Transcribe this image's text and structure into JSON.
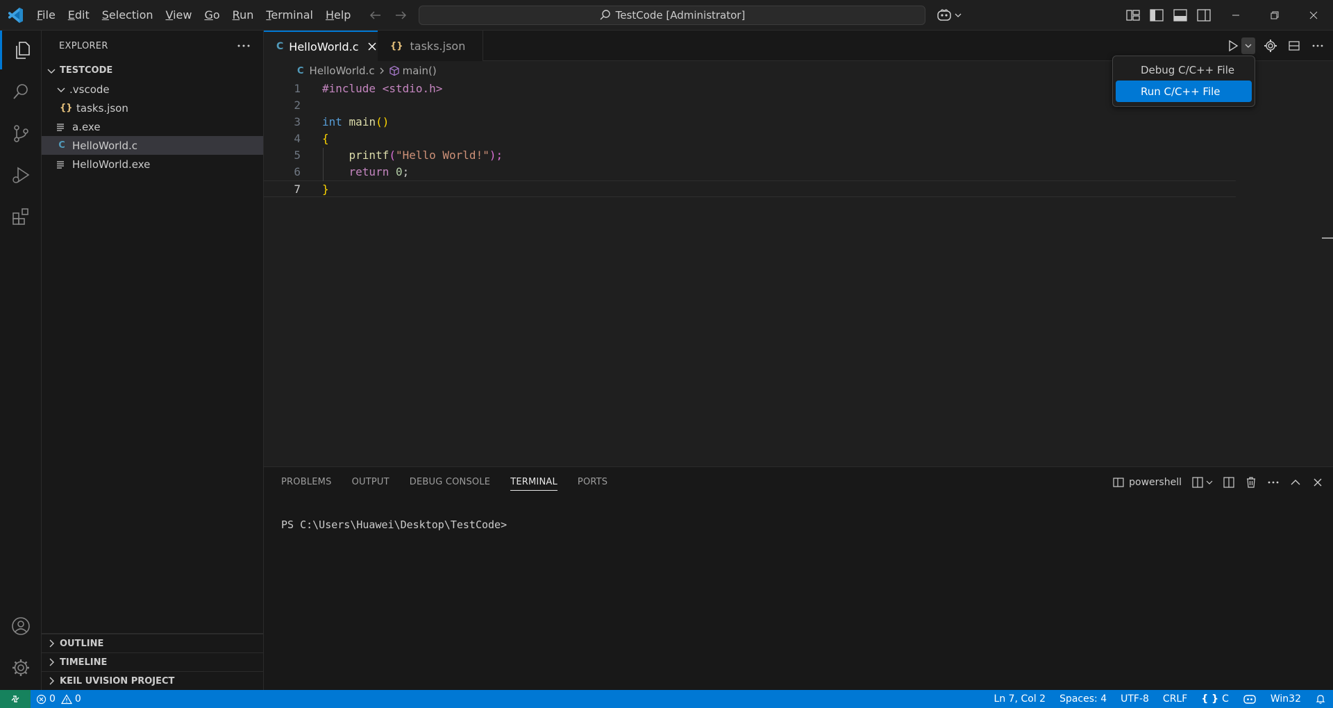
{
  "titlebar": {
    "menu": [
      {
        "label": "File",
        "key": "F",
        "rest": "ile"
      },
      {
        "label": "Edit",
        "key": "E",
        "rest": "dit"
      },
      {
        "label": "Selection",
        "key": "S",
        "rest": "election"
      },
      {
        "label": "View",
        "key": "V",
        "rest": "iew"
      },
      {
        "label": "Go",
        "key": "G",
        "rest": "o"
      },
      {
        "label": "Run",
        "key": "R",
        "rest": "un"
      },
      {
        "label": "Terminal",
        "key": "T",
        "rest": "erminal"
      },
      {
        "label": "Help",
        "key": "H",
        "rest": "elp"
      }
    ],
    "command_center": "TestCode [Administrator]"
  },
  "sidebar": {
    "title": "EXPLORER",
    "folder": "TESTCODE",
    "items": [
      {
        "label": ".vscode",
        "type": "folder"
      },
      {
        "label": "tasks.json",
        "type": "json",
        "icon": "{}"
      },
      {
        "label": "a.exe",
        "type": "file"
      },
      {
        "label": "HelloWorld.c",
        "type": "c",
        "icon": "C"
      },
      {
        "label": "HelloWorld.exe",
        "type": "file"
      }
    ],
    "bottom_sections": [
      "OUTLINE",
      "TIMELINE",
      "KEIL UVISION PROJECT"
    ]
  },
  "tabs": [
    {
      "label": "HelloWorld.c",
      "icon": "C",
      "active": true
    },
    {
      "label": "tasks.json",
      "icon": "{}",
      "active": false
    }
  ],
  "breadcrumbs": {
    "file": "HelloWorld.c",
    "symbol": "main()"
  },
  "editor": {
    "line_numbers": [
      "1",
      "2",
      "3",
      "4",
      "5",
      "6",
      "7"
    ],
    "current_line": 7,
    "code": {
      "l1_include": "#include <stdio.h>",
      "l3_type": "int",
      "l3_fn": "main",
      "l3_paren": "()",
      "l4": "{",
      "l5_fn": "printf",
      "l5_open": "(",
      "l5_str": "\"Hello World!\"",
      "l5_close": ");",
      "l6_kw": "return",
      "l6_num": "0",
      "l6_semi": ";",
      "l7": "}"
    }
  },
  "run_menu": {
    "items": [
      "Debug C/C++ File",
      "Run C/C++ File"
    ],
    "highlighted": "Run C/C++ File"
  },
  "panel": {
    "tabs": [
      "PROBLEMS",
      "OUTPUT",
      "DEBUG CONSOLE",
      "TERMINAL",
      "PORTS"
    ],
    "active_tab": "TERMINAL",
    "shell": "powershell",
    "terminal_prompt": "PS C:\\Users\\Huawei\\Desktop\\TestCode>"
  },
  "statusbar": {
    "errors": "0",
    "warnings": "0",
    "position": "Ln 7, Col 2",
    "spaces": "Spaces: 4",
    "encoding": "UTF-8",
    "eol": "CRLF",
    "language": "C",
    "platform": "Win32"
  },
  "colors": {
    "accent": "#0078d4",
    "statusbar": "#0078d4",
    "remote": "#16825d",
    "background": "#1f1f1f"
  }
}
